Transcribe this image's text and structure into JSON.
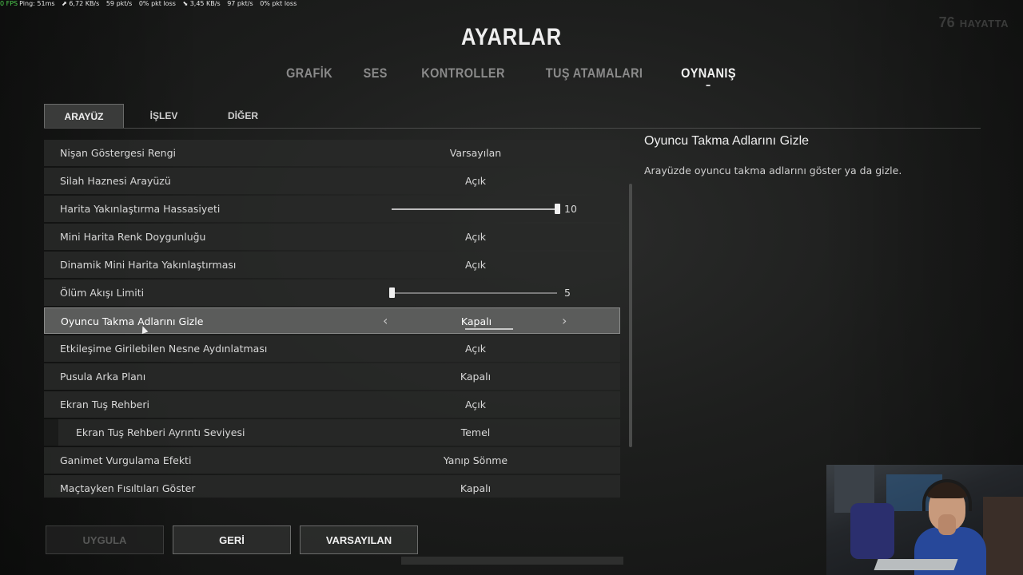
{
  "overlay": {
    "fps": "0 FPS",
    "ping": "Ping: 51ms",
    "up_rate": "⬈ 6,72 KB/s",
    "up_pkt": "59 pkt/s",
    "up_loss": "0% pkt loss",
    "down_rate": "⬊ 3,45 KB/s",
    "down_pkt": "97 pkt/s",
    "down_loss": "0% pkt loss",
    "alive_count": "76",
    "alive_label": "HAYATTA"
  },
  "page": {
    "title": "AYARLAR"
  },
  "main_tabs": [
    {
      "label": "GRAFİK"
    },
    {
      "label": "SES"
    },
    {
      "label": "KONTROLLER"
    },
    {
      "label": "TUŞ ATAMALARI"
    },
    {
      "label": "OYNANIŞ"
    }
  ],
  "sub_tabs": [
    {
      "label": "ARAYÜZ"
    },
    {
      "label": "İŞLEV"
    },
    {
      "label": "DİĞER"
    }
  ],
  "settings": [
    {
      "label": "Nişan Göstergesi Rengi",
      "value": "Varsayılan"
    },
    {
      "label": "Silah Haznesi Arayüzü",
      "value": "Açık"
    },
    {
      "label": "Harita Yakınlaştırma Hassasiyeti",
      "value": "10",
      "slider_fraction": 1.0
    },
    {
      "label": "Mini Harita Renk Doygunluğu",
      "value": "Açık"
    },
    {
      "label": "Dinamik Mini Harita Yakınlaştırması",
      "value": "Açık"
    },
    {
      "label": "Ölüm Akışı Limiti",
      "value": "5",
      "slider_fraction": 0.0
    },
    {
      "label": "Oyuncu Takma Adlarını Gizle",
      "value": "Kapalı",
      "selected": true
    },
    {
      "label": "Etkileşime Girilebilen Nesne Aydınlatması",
      "value": "Açık"
    },
    {
      "label": "Pusula Arka Planı",
      "value": "Kapalı"
    },
    {
      "label": "Ekran Tuş Rehberi",
      "value": "Açık"
    },
    {
      "label": "Ekran Tuş Rehberi Ayrıntı Seviyesi",
      "value": "Temel"
    },
    {
      "label": "Ganimet Vurgulama Efekti",
      "value": "Yanıp Sönme"
    },
    {
      "label": "Maçtayken Fısıltıları Göster",
      "value": "Kapalı"
    }
  ],
  "description": {
    "title": "Oyuncu Takma Adlarını Gizle",
    "text": "Arayüzde oyuncu takma adlarını göster ya da gizle."
  },
  "buttons": {
    "apply": "UYGULA",
    "back": "GERİ",
    "defaults": "VARSAYILAN"
  },
  "colors": {
    "accent_fps": "#4fd04f",
    "selected_row": "#5b5c5b"
  }
}
